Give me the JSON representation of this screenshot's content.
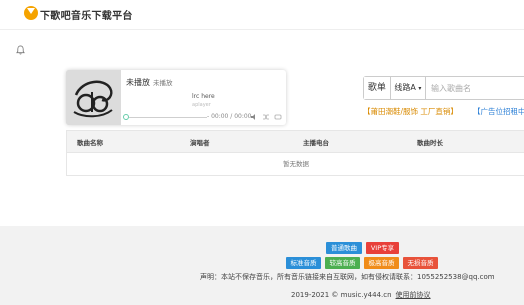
{
  "header": {
    "brand": "下歌吧音乐下载平台"
  },
  "player": {
    "song_title": "未播放",
    "song_artist": "未播放",
    "lyric_current": "lrc here",
    "lyric_next": "aplayer",
    "time": "00:00 / 00:00",
    "progress": 0
  },
  "search": {
    "search_label": "歌单",
    "line_select": "线路A",
    "placeholder": "输入歌曲名"
  },
  "ads": {
    "ad1": "【莆田潮鞋/服饰 工厂直销】",
    "ad2": "【广告位招租中"
  },
  "table": {
    "columns": [
      "歌曲名称",
      "演唱者",
      "主播电台",
      "歌曲时长"
    ],
    "empty_text": "暂无数据"
  },
  "footer": {
    "tags_row1": [
      "普通歌曲",
      "VIP专享"
    ],
    "tags_row2": [
      "标准音质",
      "较高音质",
      "极高音质",
      "无损音质"
    ],
    "disclaimer": "声明：本站不保存音乐，所有音乐链接来自互联网，如有侵权请联系：1055252538@qq.com",
    "copyright": "2019-2021 © music.y444.cn",
    "terms": "使用前协议"
  },
  "colors": {
    "brand_orange": "#f5a300",
    "tag_blue": "#2b8fd8",
    "tag_red": "#e8403a",
    "tag_green": "#4caf50",
    "tag_orange": "#f08c1a",
    "tag_red2": "#e8523a"
  }
}
